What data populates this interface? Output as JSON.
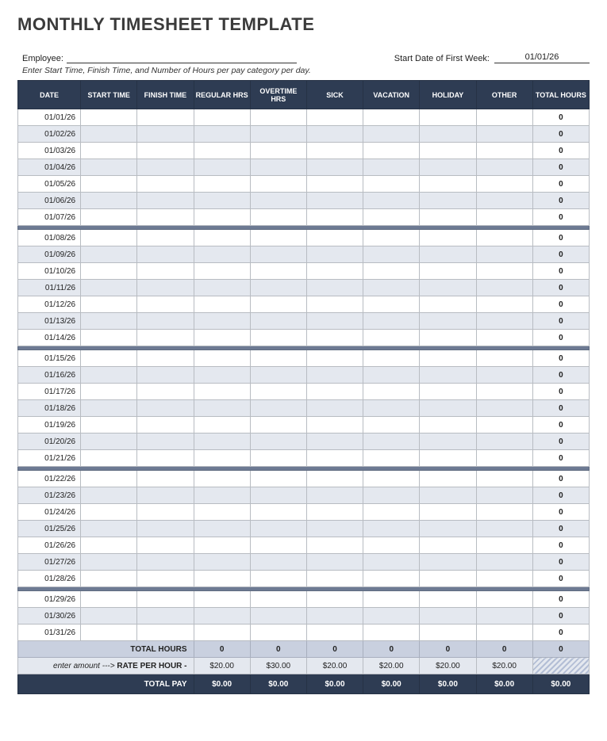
{
  "title": "MONTHLY TIMESHEET TEMPLATE",
  "meta": {
    "employee_label": "Employee:",
    "employee_value": "",
    "start_date_label": "Start Date of First Week:",
    "start_date_value": "01/01/26"
  },
  "instruction": "Enter Start Time, Finish Time, and Number of Hours per pay category per day.",
  "columns": [
    "DATE",
    "START TIME",
    "FINISH TIME",
    "REGULAR HRS",
    "OVERTIME HRS",
    "SICK",
    "VACATION",
    "HOLIDAY",
    "OTHER",
    "TOTAL HOURS"
  ],
  "weeks": [
    [
      {
        "date": "01/01/26",
        "total": "0"
      },
      {
        "date": "01/02/26",
        "total": "0"
      },
      {
        "date": "01/03/26",
        "total": "0"
      },
      {
        "date": "01/04/26",
        "total": "0"
      },
      {
        "date": "01/05/26",
        "total": "0"
      },
      {
        "date": "01/06/26",
        "total": "0"
      },
      {
        "date": "01/07/26",
        "total": "0"
      }
    ],
    [
      {
        "date": "01/08/26",
        "total": "0"
      },
      {
        "date": "01/09/26",
        "total": "0"
      },
      {
        "date": "01/10/26",
        "total": "0"
      },
      {
        "date": "01/11/26",
        "total": "0"
      },
      {
        "date": "01/12/26",
        "total": "0"
      },
      {
        "date": "01/13/26",
        "total": "0"
      },
      {
        "date": "01/14/26",
        "total": "0"
      }
    ],
    [
      {
        "date": "01/15/26",
        "total": "0"
      },
      {
        "date": "01/16/26",
        "total": "0"
      },
      {
        "date": "01/17/26",
        "total": "0"
      },
      {
        "date": "01/18/26",
        "total": "0"
      },
      {
        "date": "01/19/26",
        "total": "0"
      },
      {
        "date": "01/20/26",
        "total": "0"
      },
      {
        "date": "01/21/26",
        "total": "0"
      }
    ],
    [
      {
        "date": "01/22/26",
        "total": "0"
      },
      {
        "date": "01/23/26",
        "total": "0"
      },
      {
        "date": "01/24/26",
        "total": "0"
      },
      {
        "date": "01/25/26",
        "total": "0"
      },
      {
        "date": "01/26/26",
        "total": "0"
      },
      {
        "date": "01/27/26",
        "total": "0"
      },
      {
        "date": "01/28/26",
        "total": "0"
      }
    ],
    [
      {
        "date": "01/29/26",
        "total": "0"
      },
      {
        "date": "01/30/26",
        "total": "0"
      },
      {
        "date": "01/31/26",
        "total": "0"
      }
    ]
  ],
  "totals": {
    "total_hours_label": "TOTAL HOURS",
    "total_hours": [
      "0",
      "0",
      "0",
      "0",
      "0",
      "0",
      "0"
    ],
    "rate_prefix": "enter amount --->",
    "rate_label": "RATE PER HOUR -",
    "rates": [
      "$20.00",
      "$30.00",
      "$20.00",
      "$20.00",
      "$20.00",
      "$20.00"
    ],
    "total_pay_label": "TOTAL PAY",
    "total_pay": [
      "$0.00",
      "$0.00",
      "$0.00",
      "$0.00",
      "$0.00",
      "$0.00",
      "$0.00"
    ]
  }
}
